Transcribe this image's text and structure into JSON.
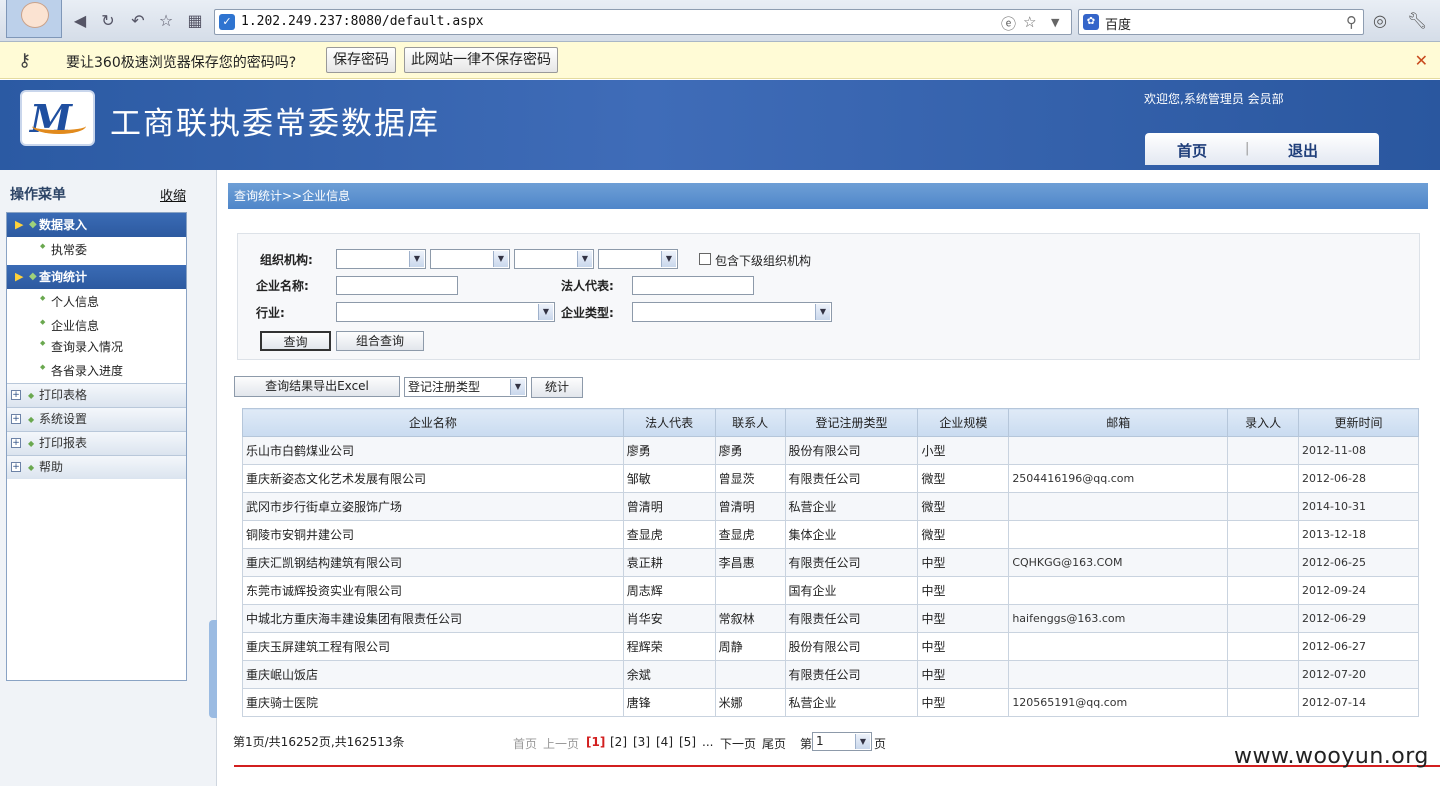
{
  "browser": {
    "url": "1.202.249.237:8080/default.aspx",
    "search_engine": "百度"
  },
  "password_bar": {
    "message": "要让360极速浏览器保存您的密码吗?",
    "save_label": "保存密码",
    "never_label": "此网站一律不保存密码"
  },
  "header": {
    "site_title": "工商联执委常委数据库",
    "welcome": "欢迎您,系统管理员 会员部",
    "nav": {
      "home": "首页",
      "sep": "|",
      "logout": "退出"
    }
  },
  "sidebar": {
    "title": "操作菜单",
    "collapse_label": "收缩",
    "groups": [
      {
        "label": "数据录入",
        "items": [
          "执常委"
        ]
      },
      {
        "label": "查询统计",
        "items": [
          "个人信息",
          "企业信息",
          "查询录入情况",
          "各省录入进度"
        ]
      }
    ],
    "collapsed_groups": [
      "打印表格",
      "系统设置",
      "打印报表",
      "帮助"
    ]
  },
  "breadcrumb": "查询统计>>企业信息",
  "filters": {
    "org_label": "组织机构:",
    "include_sub_label": "包含下级组织机构",
    "company_label": "企业名称:",
    "legal_label": "法人代表:",
    "industry_label": "行业:",
    "type_label": "企业类型:",
    "query_label": "查询",
    "combo_query_label": "组合查询"
  },
  "toolbar": {
    "export_label": "查询结果导出Excel",
    "stat_select_value": "登记注册类型",
    "stat_label": "统计"
  },
  "table": {
    "headers": [
      "企业名称",
      "法人代表",
      "联系人",
      "登记注册类型",
      "企业规模",
      "邮箱",
      "录入人",
      "更新时间"
    ],
    "rows": [
      [
        "乐山市白鹤煤业公司",
        "廖勇",
        "廖勇",
        "股份有限公司",
        "小型",
        "",
        "",
        "2012-11-08"
      ],
      [
        "重庆新姿态文化艺术发展有限公司",
        "邹敏",
        "曾显茨",
        "有限责任公司",
        "微型",
        "2504416196@qq.com",
        "",
        "2012-06-28"
      ],
      [
        "武冈市步行街卓立姿服饰广场",
        "曾清明",
        "曾清明",
        "私营企业",
        "微型",
        "",
        "",
        "2014-10-31"
      ],
      [
        "铜陵市安铜井建公司",
        "查显虎",
        "查显虎",
        "集体企业",
        "微型",
        "",
        "",
        "2013-12-18"
      ],
      [
        "重庆汇凯钢结构建筑有限公司",
        "袁正耕",
        "李昌惠",
        "有限责任公司",
        "中型",
        "CQHKGG@163.COM",
        "",
        "2012-06-25"
      ],
      [
        "东莞市诚辉投资实业有限公司",
        "周志辉",
        "",
        "国有企业",
        "中型",
        "",
        "",
        "2012-09-24"
      ],
      [
        "中城北方重庆海丰建设集团有限责任公司",
        "肖华安",
        "常叙林",
        "有限责任公司",
        "中型",
        "haifenggs@163.com",
        "",
        "2012-06-29"
      ],
      [
        "重庆玉屏建筑工程有限公司",
        "程辉荣",
        "周静",
        "股份有限公司",
        "中型",
        "",
        "",
        "2012-06-27"
      ],
      [
        "重庆岷山饭店",
        "余斌",
        "",
        "有限责任公司",
        "中型",
        "",
        "",
        "2012-07-20"
      ],
      [
        "重庆骑士医院",
        "唐锋",
        "米娜",
        "私营企业",
        "中型",
        "120565191@qq.com",
        "",
        "2012-07-14"
      ]
    ]
  },
  "pagination": {
    "info": "第1页/共16252页,共162513条",
    "first": "首页",
    "prev": "上一页",
    "pages": [
      "[1]",
      "[2]",
      "[3]",
      "[4]",
      "[5]"
    ],
    "ellipsis": "...",
    "next": "下一页",
    "last": "尾页",
    "goto_prefix": "第",
    "goto_value": "1",
    "goto_suffix": "页"
  },
  "watermark": "www.wooyun.org"
}
